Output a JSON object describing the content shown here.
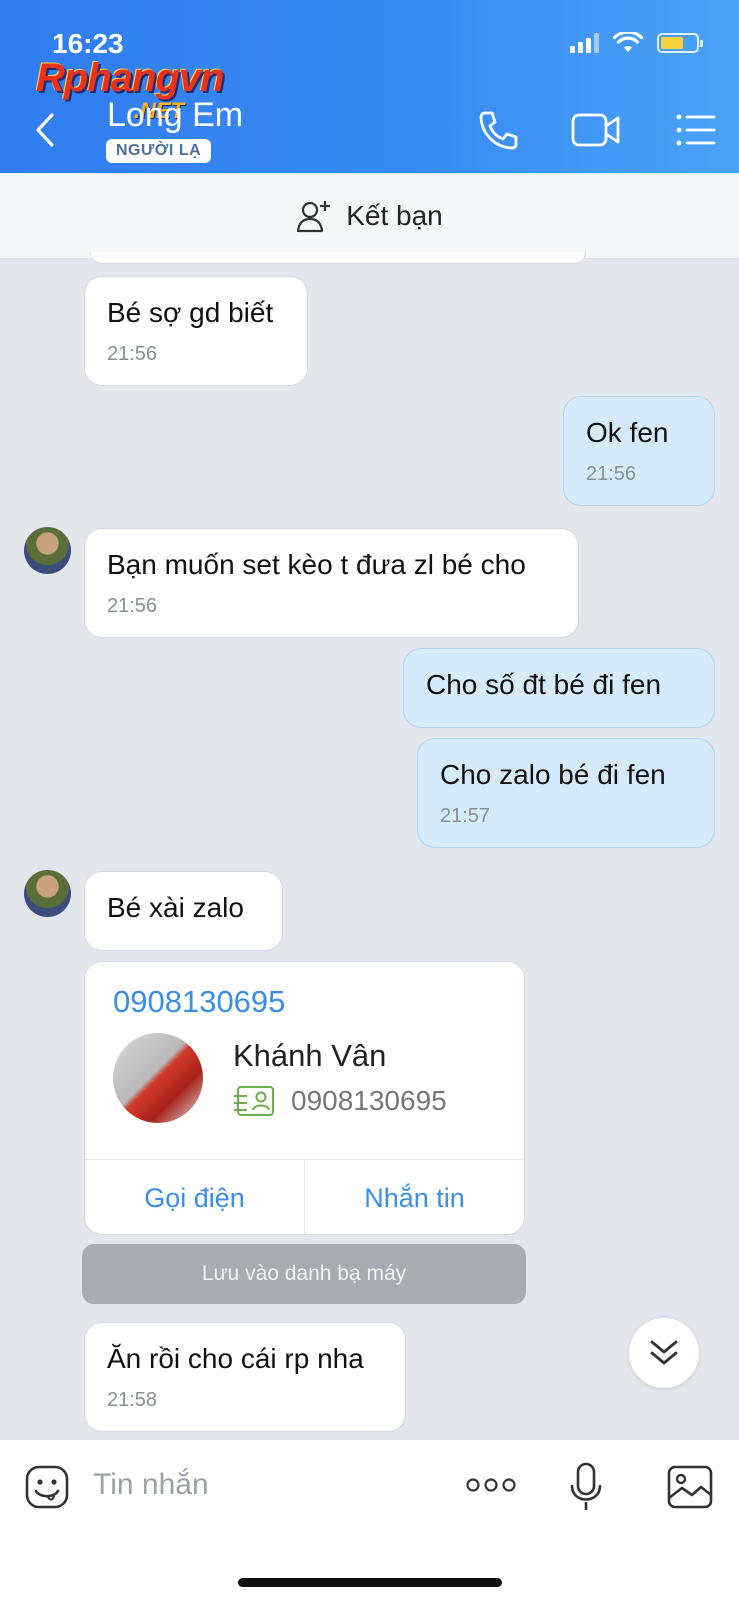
{
  "status_bar": {
    "time": "16:23"
  },
  "watermark": {
    "brand": "Rphangvn",
    "suffix": ".NET"
  },
  "header": {
    "title": "Long Em",
    "badge": "NGƯỜI LẠ"
  },
  "add_friend": {
    "label": "Kết bạn"
  },
  "messages": [
    {
      "text": "Bé sợ gd biết",
      "time": "21:56",
      "side": "in"
    },
    {
      "text": "Ok fen",
      "time": "21:56",
      "side": "out"
    },
    {
      "text": "Bạn muốn set kèo t đưa zl bé cho",
      "time": "21:56",
      "side": "in"
    },
    {
      "text": "Cho số đt bé đi fen",
      "side": "out"
    },
    {
      "text": "Cho zalo bé đi fen",
      "time": "21:57",
      "side": "out"
    },
    {
      "text": "Bé xài zalo",
      "side": "in"
    },
    {
      "text": "Ăn rồi cho cái rp nha",
      "time": "21:58",
      "side": "in"
    }
  ],
  "contact_card": {
    "phone_title": "0908130695",
    "name": "Khánh Vân",
    "phone": "0908130695",
    "call_label": "Gọi điện",
    "message_label": "Nhắn tin"
  },
  "save_contact": {
    "label": "Lưu vào danh bạ máy"
  },
  "input": {
    "placeholder": "Tin nhắn"
  }
}
